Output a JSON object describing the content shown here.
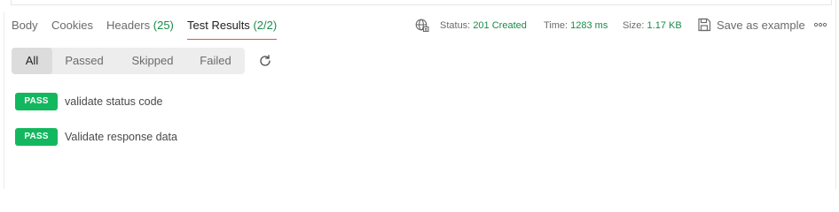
{
  "tabs": [
    {
      "label": "Body",
      "count": ""
    },
    {
      "label": "Cookies",
      "count": ""
    },
    {
      "label": "Headers",
      "count": "(25)"
    },
    {
      "label": "Test Results",
      "count": "(2/2)"
    }
  ],
  "active_tab": "Test Results",
  "response": {
    "status_label": "Status:",
    "status_value": "201 Created",
    "time_label": "Time:",
    "time_value": "1283 ms",
    "size_label": "Size:",
    "size_value": "1.17 KB",
    "save_label": "Save as example"
  },
  "filters": [
    "All",
    "Passed",
    "Skipped",
    "Failed"
  ],
  "active_filter": "All",
  "results": [
    {
      "status": "PASS",
      "name": "validate status code"
    },
    {
      "status": "PASS",
      "name": "Validate response data"
    }
  ],
  "colors": {
    "accent": "#e4572e",
    "pass": "#13b85e",
    "status_text": "#1a8a4a"
  },
  "icons": [
    "globe-icon",
    "save-icon",
    "more-options-icon",
    "refresh-icon"
  ]
}
